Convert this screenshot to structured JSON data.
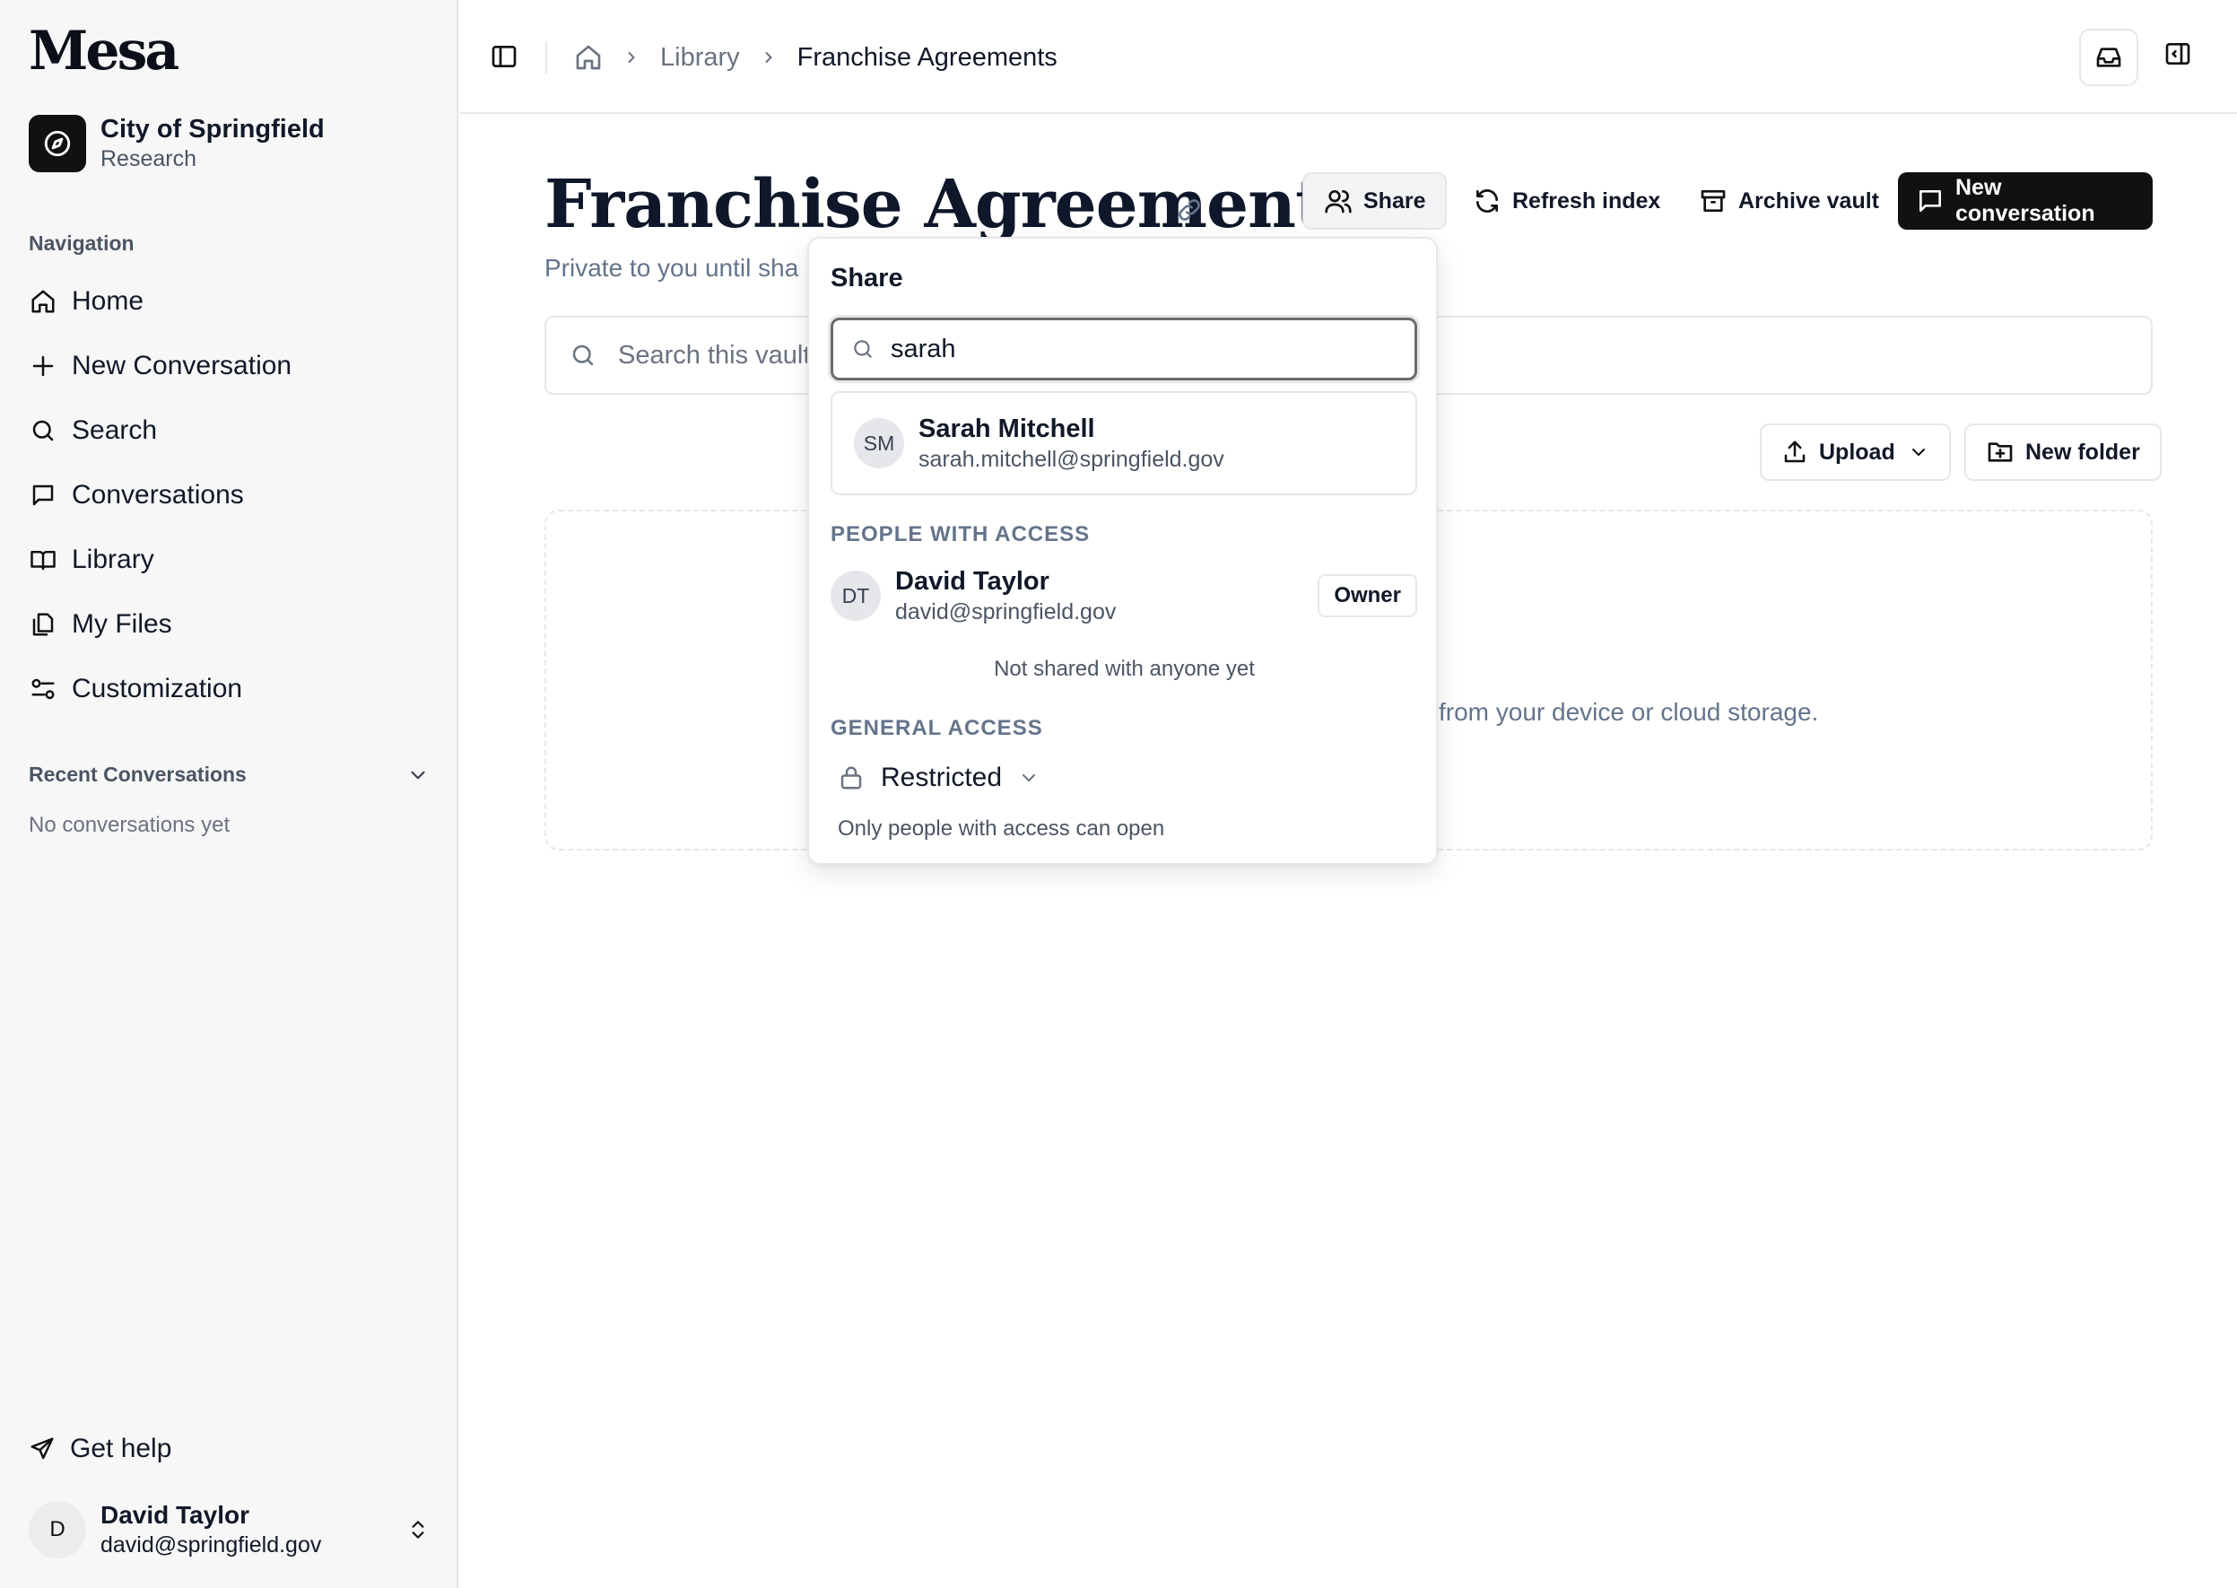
{
  "app": {
    "logo": "Mesa"
  },
  "org": {
    "name": "City of Springfield",
    "sub": "Research"
  },
  "sidebar": {
    "nav_title": "Navigation",
    "items": [
      {
        "label": "Home",
        "icon": "home-icon"
      },
      {
        "label": "New Conversation",
        "icon": "plus-icon"
      },
      {
        "label": "Search",
        "icon": "search-icon"
      },
      {
        "label": "Conversations",
        "icon": "chat-icon"
      },
      {
        "label": "Library",
        "icon": "book-icon"
      },
      {
        "label": "My Files",
        "icon": "files-icon"
      },
      {
        "label": "Customization",
        "icon": "sliders-icon"
      }
    ],
    "recent_title": "Recent Conversations",
    "no_conversations": "No conversations yet",
    "help": "Get help"
  },
  "user": {
    "initial": "D",
    "name": "David Taylor",
    "email": "david@springfield.gov"
  },
  "breadcrumb": {
    "library": "Library",
    "current": "Franchise Agreements"
  },
  "page": {
    "title": "Franchise Agreements",
    "subtitle": "Private to you until sha",
    "search_placeholder": "Search this vault",
    "dropzone_text": "from your device or cloud storage."
  },
  "actions": {
    "share": "Share",
    "refresh": "Refresh index",
    "archive": "Archive vault",
    "new_conversation": "New conversation",
    "upload": "Upload",
    "new_folder": "New folder"
  },
  "share_popover": {
    "title": "Share",
    "search_value": "sarah",
    "suggestion": {
      "initials": "SM",
      "name": "Sarah Mitchell",
      "email": "sarah.mitchell@springfield.gov"
    },
    "people_label": "PEOPLE WITH ACCESS",
    "owner": {
      "initials": "DT",
      "name": "David Taylor",
      "email": "david@springfield.gov",
      "role": "Owner"
    },
    "not_shared": "Not shared with anyone yet",
    "general_label": "GENERAL ACCESS",
    "access_level": "Restricted",
    "access_desc": "Only people with access can open"
  },
  "colors": {
    "primary_button": "#111111",
    "muted_text": "#64748b",
    "border": "#e5e7eb"
  }
}
